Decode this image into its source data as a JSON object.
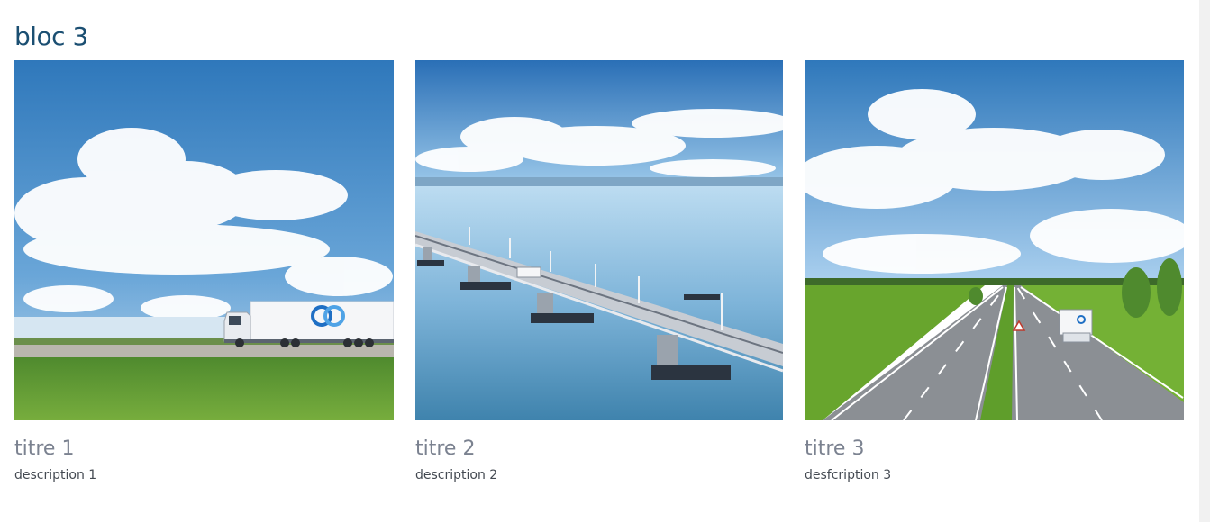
{
  "section": {
    "title": "bloc 3"
  },
  "cards": [
    {
      "title": "titre 1",
      "description": "description 1",
      "image": "truck-on-road-under-sky"
    },
    {
      "title": "titre 2",
      "description": "description 2",
      "image": "bridge-over-sea-with-truck"
    },
    {
      "title": "titre 3",
      "description": "desfcription 3",
      "image": "highway-through-fields-with-truck"
    }
  ],
  "colors": {
    "title": "#1b4f72",
    "card_title": "#7b8290",
    "description": "#444a52",
    "logo_blue": "#1f6fc4"
  }
}
